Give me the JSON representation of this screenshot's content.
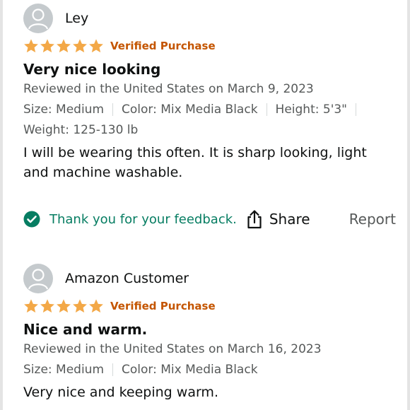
{
  "reviews": [
    {
      "reviewer": "Ley",
      "badge": "Verified Purchase",
      "stars": 5,
      "title": "Very nice looking",
      "date_line": "Reviewed in the United States on March 9, 2023",
      "variants": [
        "Size: Medium",
        "Color: Mix Media Black",
        "Height: 5'3\""
      ],
      "weight": "Weight: 125-130 lb",
      "text": "I will be wearing this often. It is sharp looking, light and machine washable.",
      "feedback": "Thank you for your feedback.",
      "share_label": "Share",
      "report_label": "Report"
    },
    {
      "reviewer": "Amazon Customer",
      "badge": "Verified Purchase",
      "stars": 5,
      "title": "Nice and warm.",
      "date_line": "Reviewed in the United States on March 16, 2023",
      "variants": [
        "Size: Medium",
        "Color: Mix Media Black"
      ],
      "text": "Very nice and keeping warm."
    }
  ],
  "icons": {
    "avatar": "person-silhouette-icon",
    "star": "star-icon",
    "check": "check-circle-icon",
    "share": "share-icon"
  },
  "colors": {
    "star": "#f3a847",
    "verified": "#c45500",
    "feedback": "#067d62",
    "secondary_text": "#565959"
  }
}
